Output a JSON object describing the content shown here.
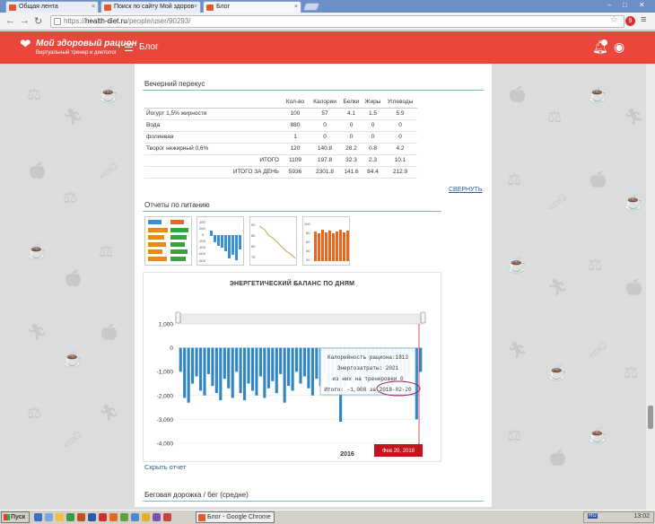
{
  "browser": {
    "tabs": [
      {
        "label": "Общая лента",
        "active": false
      },
      {
        "label": "Поиск по сайту Мой здоров",
        "active": false
      },
      {
        "label": "Блог",
        "active": true
      }
    ],
    "url_scheme": "https://",
    "url_host": "health-diet.ru",
    "url_path": "/people/user/90293/",
    "ext_badge": "9"
  },
  "site": {
    "logo_title": "Мой здоровый рацион",
    "logo_subtitle": "Виртуальный тренер и диетолог",
    "section": "Блог"
  },
  "meal": {
    "title": "Вечерний перекус",
    "headers": [
      "Кол-во",
      "Калории",
      "Белки",
      "Жиры",
      "Углеводы"
    ],
    "rows": [
      {
        "name": "Йогурт 1,5% жирности",
        "values": [
          "100",
          "57",
          "4.1",
          "1.5",
          "5.9"
        ]
      },
      {
        "name": "Вода",
        "values": [
          "880",
          "0",
          "0",
          "0",
          "0"
        ]
      },
      {
        "name": "фолиевая",
        "values": [
          "1",
          "0",
          "0",
          "0",
          "0"
        ]
      },
      {
        "name": "Творог нежирный 0,6%",
        "values": [
          "120",
          "140.8",
          "28.2",
          "0.8",
          "4.2"
        ]
      }
    ],
    "total_label": "ИТОГО",
    "total_values": [
      "1109",
      "197.8",
      "32.3",
      "2.3",
      "10.1"
    ],
    "day_total_label": "ИТОГО ЗА ДЕНЬ",
    "day_total_values": [
      "5936",
      "2301.8",
      "141.6",
      "84.4",
      "212.9"
    ],
    "collapse_label": "СВЕРНУТЬ"
  },
  "reports": {
    "title": "Отчеты по питанию",
    "hide_label": "Скрыть отчет",
    "thumb_axis_a": [
      "400",
      "200",
      "0",
      "-200",
      "-400",
      "-600",
      "-800"
    ],
    "thumb_axis_b": [
      "90",
      "85",
      "80",
      "75"
    ],
    "thumb_axis_c": [
      "100",
      "80",
      "60",
      "40",
      "20"
    ]
  },
  "chart_data": {
    "type": "bar",
    "title": "ЭНЕРГЕТИЧЕСКИЙ БАЛАНС ПО ДНЯМ",
    "ylim": [
      -4000,
      1000
    ],
    "yticks": [
      "1,000",
      "0",
      "-1,000",
      "-2,000",
      "-3,000",
      "-4,000"
    ],
    "x_tick": "2016",
    "values": [
      -1000,
      -2100,
      -2300,
      -1500,
      -1200,
      -1800,
      -2000,
      -1100,
      -1600,
      -1900,
      -2200,
      -1300,
      -1700,
      -2100,
      -1000,
      -1900,
      -2200,
      -1500,
      -1800,
      -2000,
      -1200,
      -2100,
      -1700,
      -1400,
      -1900,
      -1100,
      -2300,
      -1600,
      -1800,
      -1000,
      -1500,
      -1200,
      -1700,
      -2000,
      -1300,
      -1600,
      -1100,
      -1900,
      -1400,
      -1700,
      -3100,
      -1600,
      -1200,
      -1500,
      -900,
      -1700,
      -1300,
      -1500,
      -1800,
      -1000,
      -1700,
      -1400,
      -1200,
      -1600,
      -1300,
      -1000,
      -1500,
      -1300,
      -200,
      -3000,
      -1008
    ],
    "tooltip": {
      "line1": "Калорийность рациона:1813",
      "line2": "Энергозатраты: 2021",
      "line3": "из них на тренировки 0",
      "line4": "Итого: -1,008 за 2018-02-20"
    },
    "crosshair_label": "Фев 20, 2018"
  },
  "next_section": {
    "title": "Беговая дорожка / бег (средне)"
  },
  "taskbar": {
    "start": "Пуск",
    "active_window": "Блог - Google Chrome",
    "lang": "RU",
    "clock": "13:02"
  }
}
